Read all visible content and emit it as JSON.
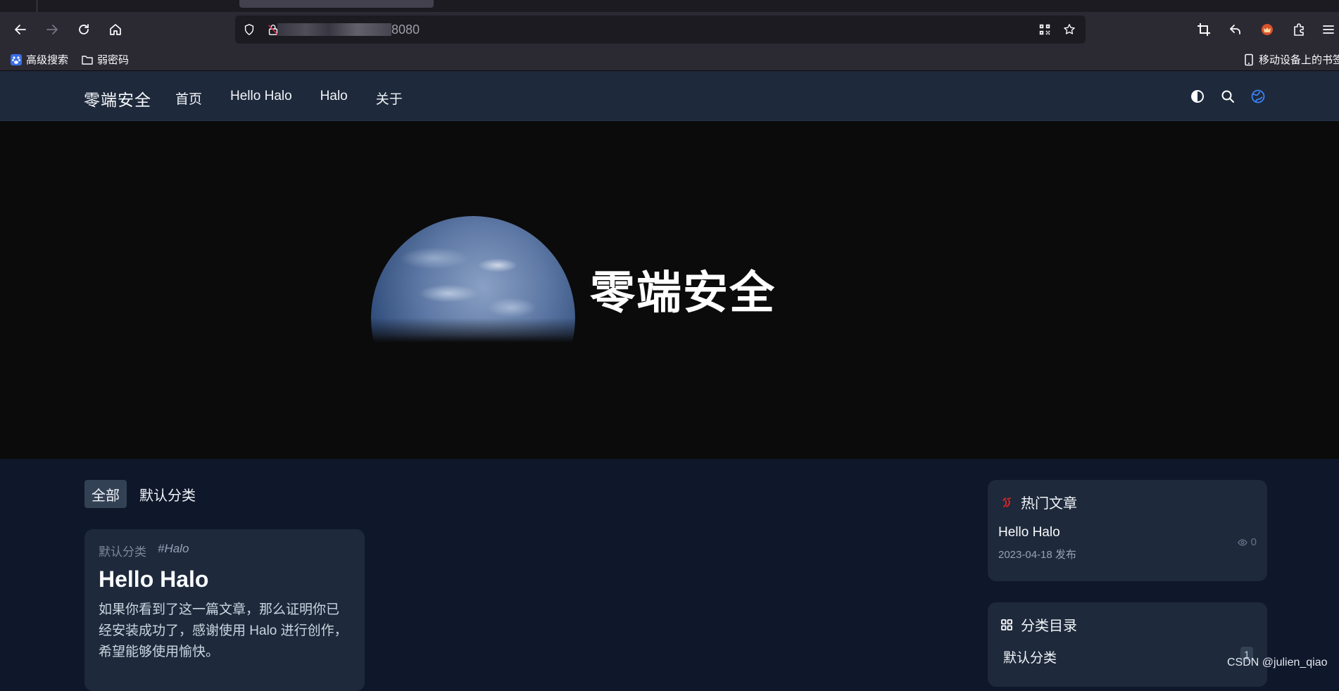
{
  "browser": {
    "url_visible_suffix": "8080",
    "bookmarks": [
      {
        "label": "高级搜索",
        "icon": "baidu-paw-icon"
      },
      {
        "label": "弱密码",
        "icon": "folder-icon"
      }
    ],
    "mobile_bookmarks_label": "移动设备上的书签"
  },
  "site": {
    "logo": "零端安全",
    "nav": [
      "首页",
      "Hello Halo",
      "Halo",
      "关于"
    ],
    "accent_color": "#3b82f6"
  },
  "hero": {
    "title": "零端安全"
  },
  "categories_tabs": [
    {
      "label": "全部",
      "active": true
    },
    {
      "label": "默认分类",
      "active": false
    }
  ],
  "post": {
    "category": "默认分类",
    "tag": "#Halo",
    "title": "Hello Halo",
    "excerpt": "如果你看到了这一篇文章，那么证明你已经安装成功了，感谢使用 Halo 进行创作，希望能够使用愉快。"
  },
  "hot_widget": {
    "title": "热门文章",
    "items": [
      {
        "title": "Hello Halo",
        "date": "2023-04-18 发布",
        "views": "0"
      }
    ]
  },
  "category_widget": {
    "title": "分类目录",
    "items": [
      {
        "label": "默认分类",
        "count": "1"
      }
    ]
  },
  "watermark": "CSDN @julien_qiao"
}
